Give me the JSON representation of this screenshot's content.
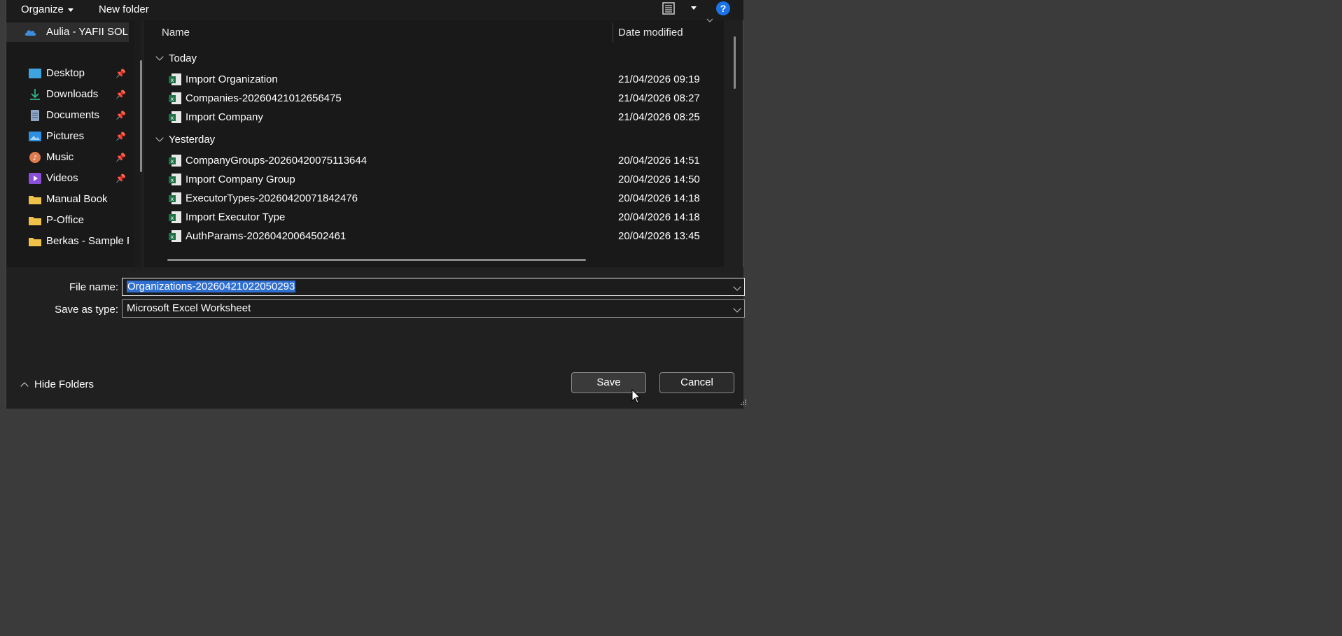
{
  "toolbar": {
    "organize_label": "Organize",
    "new_folder_label": "New folder"
  },
  "nav": {
    "items": [
      {
        "label": "Aulia - YAFII SOLU",
        "icon": "onedrive-cloud-icon"
      },
      {
        "label": "Desktop",
        "icon": "desktop-icon",
        "pinned": true
      },
      {
        "label": "Downloads",
        "icon": "download-icon",
        "pinned": true
      },
      {
        "label": "Documents",
        "icon": "documents-icon",
        "pinned": true
      },
      {
        "label": "Pictures",
        "icon": "pictures-icon",
        "pinned": true
      },
      {
        "label": "Music",
        "icon": "music-icon",
        "pinned": true
      },
      {
        "label": "Videos",
        "icon": "videos-icon",
        "pinned": true
      },
      {
        "label": "Manual Book",
        "icon": "folder-icon"
      },
      {
        "label": "P-Office",
        "icon": "folder-icon"
      },
      {
        "label": "Berkas - Sample F",
        "icon": "folder-icon"
      }
    ]
  },
  "files": {
    "columns": {
      "name": "Name",
      "date": "Date modified"
    },
    "groups": [
      {
        "label": "Today",
        "rows": [
          {
            "name": "Import Organization",
            "date": "21/04/2026 09:19"
          },
          {
            "name": "Companies-20260421012656475",
            "date": "21/04/2026 08:27"
          },
          {
            "name": "Import Company",
            "date": "21/04/2026 08:25"
          }
        ]
      },
      {
        "label": "Yesterday",
        "rows": [
          {
            "name": "CompanyGroups-20260420075113644",
            "date": "20/04/2026 14:51"
          },
          {
            "name": "Import Company Group",
            "date": "20/04/2026 14:50"
          },
          {
            "name": "ExecutorTypes-20260420071842476",
            "date": "20/04/2026 14:18"
          },
          {
            "name": "Import Executor Type",
            "date": "20/04/2026 14:18"
          },
          {
            "name": "AuthParams-20260420064502461",
            "date": "20/04/2026 13:45"
          }
        ]
      }
    ]
  },
  "form": {
    "file_name_label": "File name:",
    "file_name_value": "Organizations-20260421022050293",
    "save_type_label": "Save as type:",
    "save_type_value": "Microsoft Excel Worksheet"
  },
  "footer": {
    "hide_folders_label": "Hide Folders",
    "save_label": "Save",
    "cancel_label": "Cancel"
  },
  "colors": {
    "accent": "#2f6fd1",
    "excel_green": "#1e7145",
    "folder_yellow": "#f0c24a"
  }
}
